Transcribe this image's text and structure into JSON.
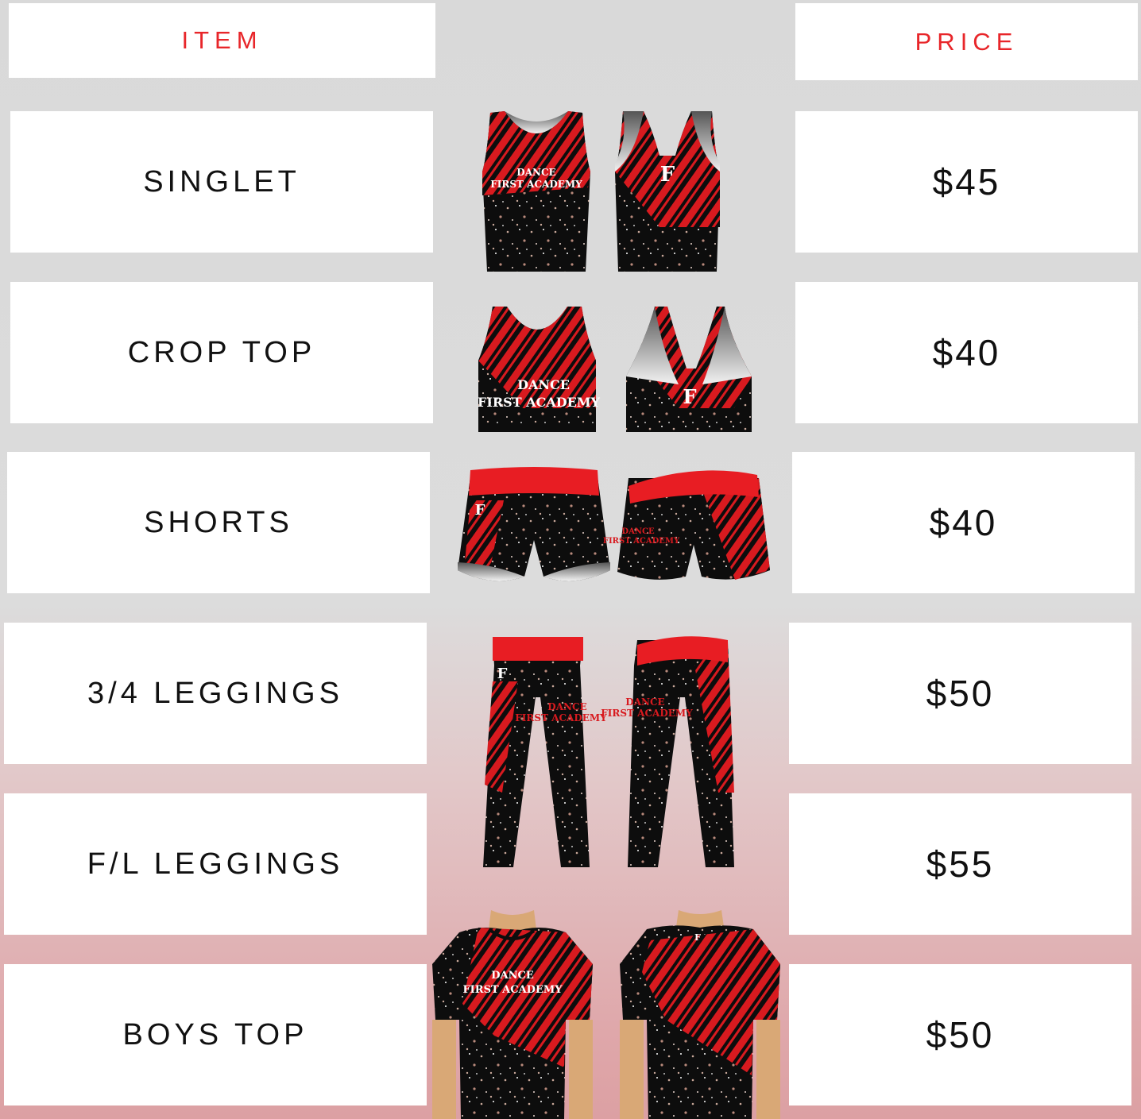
{
  "header": {
    "item_label": "ITEM",
    "price_label": "PRICE"
  },
  "rows": [
    {
      "name": "SINGLET",
      "price": "$45"
    },
    {
      "name": "CROP TOP",
      "price": "$40"
    },
    {
      "name": "SHORTS",
      "price": "$40"
    },
    {
      "name": "3/4 LEGGINGS",
      "price": "$50"
    },
    {
      "name": "F/L LEGGINGS",
      "price": "$55"
    },
    {
      "name": "BOYS TOP",
      "price": "$50"
    }
  ],
  "brand": {
    "line1": "DANCE",
    "line2": "FIRST ACADEMY",
    "monogram": "F"
  },
  "colors": {
    "accent": "#e8262a",
    "garment_black": "#0d0d0d",
    "garment_red": "#d81a1f"
  }
}
